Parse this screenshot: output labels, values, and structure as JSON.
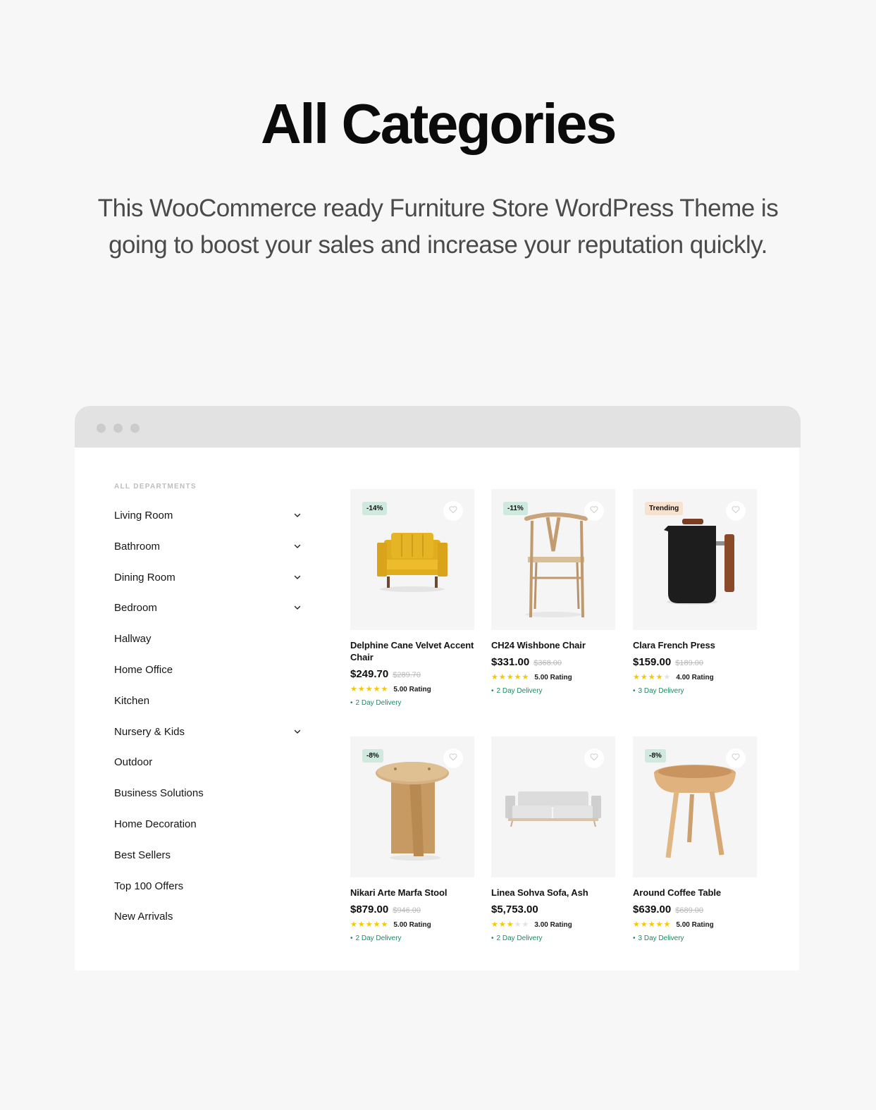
{
  "hero": {
    "title": "All Categories",
    "subtitle": "This WooCommerce ready Furniture Store WordPress Theme is going to boost your sales and increase your reputation quickly."
  },
  "colors": {
    "sale_badge": "#cfe9df",
    "trending_badge": "#f7e2d0",
    "star": "#f5c800",
    "delivery": "#1c8a5f"
  },
  "sidebar": {
    "heading": "All Departments",
    "items": [
      {
        "label": "Living Room",
        "has_submenu": true
      },
      {
        "label": "Bathroom",
        "has_submenu": true
      },
      {
        "label": "Dining Room",
        "has_submenu": true
      },
      {
        "label": "Bedroom",
        "has_submenu": true
      },
      {
        "label": "Hallway",
        "has_submenu": false
      },
      {
        "label": "Home Office",
        "has_submenu": false
      },
      {
        "label": "Kitchen",
        "has_submenu": false
      },
      {
        "label": "Nursery & Kids",
        "has_submenu": true
      },
      {
        "label": "Outdoor",
        "has_submenu": false
      },
      {
        "label": "Business Solutions",
        "has_submenu": false
      },
      {
        "label": "Home Decoration",
        "has_submenu": false
      },
      {
        "label": "Best Sellers",
        "has_submenu": false
      },
      {
        "label": "Top 100 Offers",
        "has_submenu": false
      },
      {
        "label": "New Arrivals",
        "has_submenu": false
      }
    ]
  },
  "products": [
    {
      "name": "Delphine Cane Velvet Accent Chair",
      "price": "$249.70",
      "old_price": "$289.70",
      "badge": "-14%",
      "badge_type": "sale",
      "rating": 5,
      "rating_text": "5.00 Rating",
      "delivery": "2 Day Delivery",
      "image": "yellow-armchair"
    },
    {
      "name": "CH24 Wishbone Chair",
      "price": "$331.00",
      "old_price": "$368.00",
      "badge": "-11%",
      "badge_type": "sale",
      "rating": 5,
      "rating_text": "5.00 Rating",
      "delivery": "2 Day Delivery",
      "image": "wishbone-chair"
    },
    {
      "name": "Clara French Press",
      "price": "$159.00",
      "old_price": "$189.00",
      "badge": "Trending",
      "badge_type": "trend",
      "rating": 4,
      "rating_text": "4.00 Rating",
      "delivery": "3 Day Delivery",
      "image": "french-press"
    },
    {
      "name": "Nikari Arte Marfa Stool",
      "price": "$879.00",
      "old_price": "$946.00",
      "badge": "-8%",
      "badge_type": "sale",
      "rating": 5,
      "rating_text": "5.00 Rating",
      "delivery": "2 Day Delivery",
      "image": "wooden-stool"
    },
    {
      "name": "Linea Sohva Sofa, Ash",
      "price": "$5,753.00",
      "old_price": null,
      "badge": null,
      "badge_type": null,
      "rating": 3,
      "rating_text": "3.00 Rating",
      "delivery": "2 Day Delivery",
      "image": "grey-sofa"
    },
    {
      "name": "Around Coffee Table",
      "price": "$639.00",
      "old_price": "$689.00",
      "badge": "-8%",
      "badge_type": "sale",
      "rating": 5,
      "rating_text": "5.00 Rating",
      "delivery": "3 Day Delivery",
      "image": "round-coffee-table"
    }
  ]
}
